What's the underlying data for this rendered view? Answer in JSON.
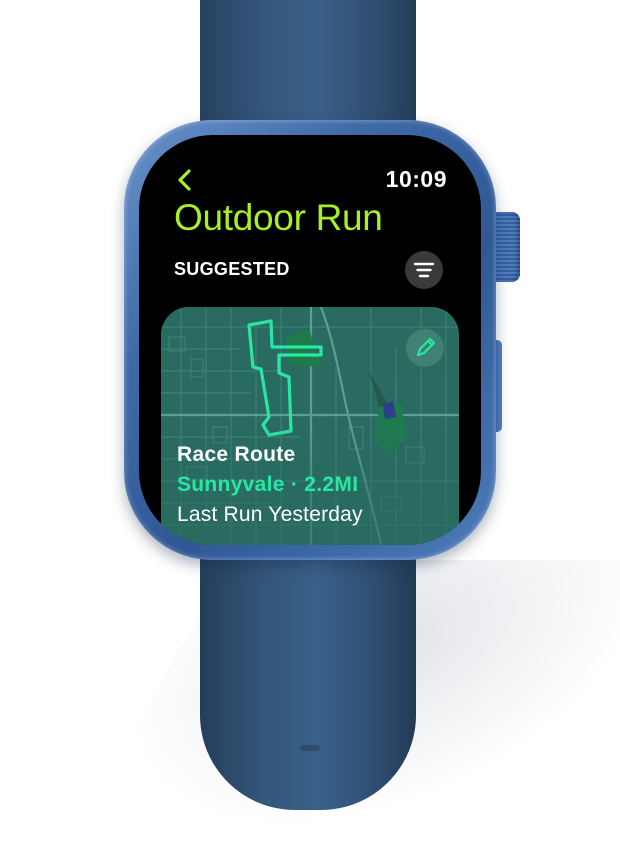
{
  "status_bar": {
    "time": "10:09"
  },
  "header": {
    "title": "Outdoor Run",
    "back_icon": "chevron-left-icon"
  },
  "section": {
    "label": "SUGGESTED",
    "filter_icon": "filter-lines-icon"
  },
  "route_card": {
    "name": "Race Route",
    "location": "Sunnyvale · 2.2MI",
    "last_run": "Last Run Yesterday",
    "edit_icon": "pencil-icon"
  },
  "colors": {
    "accent": "#a8ef25",
    "route": "#27e7a2",
    "card_bg": "#2a6b61",
    "band": "#34577d",
    "case": "#3f6aa8"
  }
}
